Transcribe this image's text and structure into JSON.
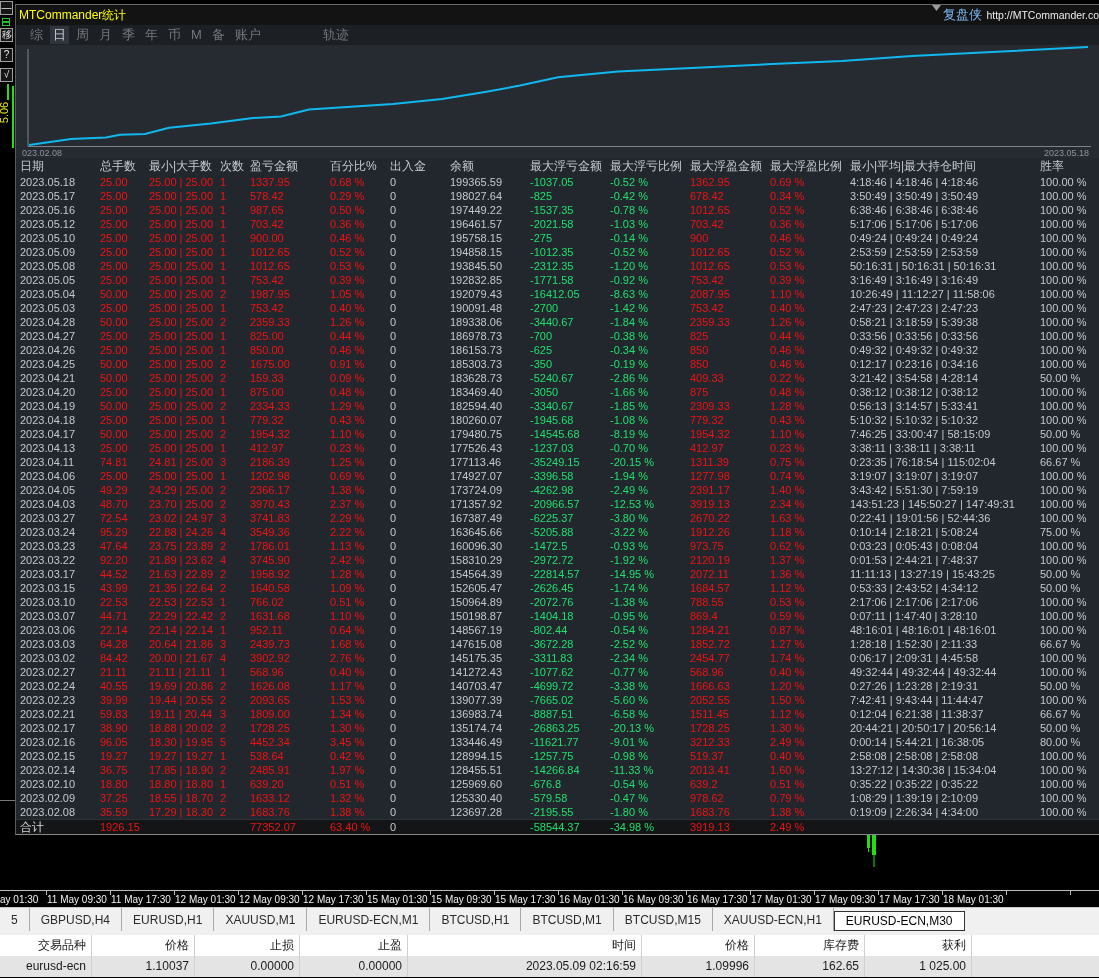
{
  "left_toolbar": {
    "buttons": [
      "—",
      "移",
      "?",
      "√"
    ],
    "price_label": "5.06"
  },
  "panel": {
    "title": "MTCommander统计",
    "brand": "复盘侠",
    "url": "http://MTCommander.co"
  },
  "tabs": [
    {
      "label": "综",
      "selected": false
    },
    {
      "label": "日",
      "selected": true
    },
    {
      "label": "周",
      "selected": false
    },
    {
      "label": "月",
      "selected": false
    },
    {
      "label": "季",
      "selected": false
    },
    {
      "label": "年",
      "selected": false
    },
    {
      "label": "币",
      "selected": false
    },
    {
      "label": "M",
      "selected": false
    },
    {
      "label": "备",
      "selected": false
    },
    {
      "label": "账户",
      "selected": false
    }
  ],
  "track_tab": {
    "label": "轨迹",
    "selected": false
  },
  "equity_chart": {
    "start_label": "023.02.08",
    "end_label": "2023.05.18"
  },
  "stats_table": {
    "columns": [
      "日期",
      "总手数",
      "最小|大手数",
      "次数",
      "盈亏金额",
      "百分比%",
      "出入金",
      "余额",
      "最大浮亏金额",
      "最大浮亏比例",
      "最大浮盈金额",
      "最大浮盈比例",
      "最小|平均|最大持仓时间",
      "胜率"
    ],
    "rows": [
      [
        "2023.05.18",
        "25.00",
        "25.00 | 25.00",
        "1",
        "1337.95",
        "0.68 %",
        "0",
        "199365.59",
        "-1037.05",
        "-0.52 %",
        "1362.95",
        "0.69 %",
        "4:18:46 | 4:18:46 | 4:18:46",
        "100.00 %"
      ],
      [
        "2023.05.17",
        "25.00",
        "25.00 | 25.00",
        "1",
        "578.42",
        "0.29 %",
        "0",
        "198027.64",
        "-825",
        "-0.42 %",
        "678.42",
        "0.34 %",
        "3:50:49 | 3:50:49 | 3:50:49",
        "100.00 %"
      ],
      [
        "2023.05.16",
        "25.00",
        "25.00 | 25.00",
        "1",
        "987.65",
        "0.50 %",
        "0",
        "197449.22",
        "-1537.35",
        "-0.78 %",
        "1012.65",
        "0.52 %",
        "6:38:46 | 6:38:46 | 6:38:46",
        "100.00 %"
      ],
      [
        "2023.05.12",
        "25.00",
        "25.00 | 25.00",
        "1",
        "703.42",
        "0.36 %",
        "0",
        "196461.57",
        "-2021.58",
        "-1.03 %",
        "703.42",
        "0.36 %",
        "5:17:06 | 5:17:06 | 5:17:06",
        "100.00 %"
      ],
      [
        "2023.05.10",
        "25.00",
        "25.00 | 25.00",
        "1",
        "900.00",
        "0.46 %",
        "0",
        "195758.15",
        "-275",
        "-0.14 %",
        "900",
        "0.46 %",
        "0:49:24 | 0:49:24 | 0:49:24",
        "100.00 %"
      ],
      [
        "2023.05.09",
        "25.00",
        "25.00 | 25.00",
        "1",
        "1012.65",
        "0.52 %",
        "0",
        "194858.15",
        "-1012.35",
        "-0.52 %",
        "1012.65",
        "0.52 %",
        "2:53:59 | 2:53:59 | 2:53:59",
        "100.00 %"
      ],
      [
        "2023.05.08",
        "25.00",
        "25.00 | 25.00",
        "1",
        "1012.65",
        "0.53 %",
        "0",
        "193845.50",
        "-2312.35",
        "-1.20 %",
        "1012.65",
        "0.53 %",
        "50:16:31 | 50:16:31 | 50:16:31",
        "100.00 %"
      ],
      [
        "2023.05.05",
        "25.00",
        "25.00 | 25.00",
        "1",
        "753.42",
        "0.39 %",
        "0",
        "192832.85",
        "-1771.58",
        "-0.92 %",
        "753.42",
        "0.39 %",
        "3:16:49 | 3:16:49 | 3:16:49",
        "100.00 %"
      ],
      [
        "2023.05.04",
        "50.00",
        "25.00 | 25.00",
        "2",
        "1987.95",
        "1.05 %",
        "0",
        "192079.43",
        "-16412.05",
        "-8.63 %",
        "2087.95",
        "1.10 %",
        "10:26:49 | 11:12:27 | 11:58:06",
        "100.00 %"
      ],
      [
        "2023.05.03",
        "25.00",
        "25.00 | 25.00",
        "1",
        "753.42",
        "0.40 %",
        "0",
        "190091.48",
        "-2700",
        "-1.42 %",
        "753.42",
        "0.40 %",
        "2:47:23 | 2:47:23 | 2:47:23",
        "100.00 %"
      ],
      [
        "2023.04.28",
        "50.00",
        "25.00 | 25.00",
        "2",
        "2359.33",
        "1.26 %",
        "0",
        "189338.06",
        "-3440.67",
        "-1.84 %",
        "2359.33",
        "1.26 %",
        "0:58:21 | 3:18:59 | 5:39:38",
        "100.00 %"
      ],
      [
        "2023.04.27",
        "25.00",
        "25.00 | 25.00",
        "1",
        "825.00",
        "0.44 %",
        "0",
        "186978.73",
        "-700",
        "-0.38 %",
        "825",
        "0.44 %",
        "0:33:56 | 0:33:56 | 0:33:56",
        "100.00 %"
      ],
      [
        "2023.04.26",
        "25.00",
        "25.00 | 25.00",
        "1",
        "850.00",
        "0.46 %",
        "0",
        "186153.73",
        "-625",
        "-0.34 %",
        "850",
        "0.46 %",
        "0:49:32 | 0:49:32 | 0:49:32",
        "100.00 %"
      ],
      [
        "2023.04.25",
        "50.00",
        "25.00 | 25.00",
        "2",
        "1675.00",
        "0.91 %",
        "0",
        "185303.73",
        "-350",
        "-0.19 %",
        "850",
        "0.46 %",
        "0:12:17 | 0:23:16 | 0:34:16",
        "100.00 %"
      ],
      [
        "2023.04.21",
        "50.00",
        "25.00 | 25.00",
        "2",
        "159.33",
        "0.09 %",
        "0",
        "183628.73",
        "-5240.67",
        "-2.86 %",
        "409.33",
        "0.22 %",
        "3:21:42 | 3:54:58 | 4:28:14",
        "50.00 %"
      ],
      [
        "2023.04.20",
        "25.00",
        "25.00 | 25.00",
        "1",
        "875.00",
        "0.48 %",
        "0",
        "183469.40",
        "-3050",
        "-1.66 %",
        "875",
        "0.48 %",
        "0:38:12 | 0:38:12 | 0:38:12",
        "100.00 %"
      ],
      [
        "2023.04.19",
        "50.00",
        "25.00 | 25.00",
        "2",
        "2334.33",
        "1.29 %",
        "0",
        "182594.40",
        "-3340.67",
        "-1.85 %",
        "2309.33",
        "1.28 %",
        "0:56:13 | 3:14:57 | 5:33:41",
        "100.00 %"
      ],
      [
        "2023.04.18",
        "25.00",
        "25.00 | 25.00",
        "1",
        "779.32",
        "0.43 %",
        "0",
        "180260.07",
        "-1945.68",
        "-1.08 %",
        "779.32",
        "0.43 %",
        "5:10:32 | 5:10:32 | 5:10:32",
        "100.00 %"
      ],
      [
        "2023.04.17",
        "50.00",
        "25.00 | 25.00",
        "2",
        "1954.32",
        "1.10 %",
        "0",
        "179480.75",
        "-14545.68",
        "-8.19 %",
        "1954.32",
        "1.10 %",
        "7:46:25 | 33:00:47 | 58:15:09",
        "50.00 %"
      ],
      [
        "2023.04.13",
        "25.00",
        "25.00 | 25.00",
        "1",
        "412.97",
        "0.23 %",
        "0",
        "177526.43",
        "-1237.03",
        "-0.70 %",
        "412.97",
        "0.23 %",
        "3:38:11 | 3:38:11 | 3:38:11",
        "100.00 %"
      ],
      [
        "2023.04.11",
        "74.81",
        "24.81 | 25.00",
        "3",
        "2186.39",
        "1.25 %",
        "0",
        "177113.46",
        "-35249.15",
        "-20.15 %",
        "1311.39",
        "0.75 %",
        "0:23:35 | 76:18:54 | 115:02:04",
        "66.67 %"
      ],
      [
        "2023.04.06",
        "25.00",
        "25.00 | 25.00",
        "1",
        "1202.98",
        "0.69 %",
        "0",
        "174927.07",
        "-3396.58",
        "-1.94 %",
        "1277.98",
        "0.74 %",
        "3:19:07 | 3:19:07 | 3:19:07",
        "100.00 %"
      ],
      [
        "2023.04.05",
        "49.29",
        "24.29 | 25.00",
        "2",
        "2366.17",
        "1.38 %",
        "0",
        "173724.09",
        "-4262.98",
        "-2.49 %",
        "2391.17",
        "1.40 %",
        "3:43:42 | 5:51:30 | 7:59:19",
        "100.00 %"
      ],
      [
        "2023.04.03",
        "48.70",
        "23.70 | 25.00",
        "2",
        "3970.43",
        "2.37 %",
        "0",
        "171357.92",
        "-20966.57",
        "-12.53 %",
        "3919.13",
        "2.34 %",
        "143:51:23 | 145:50:27 | 147:49:31",
        "100.00 %"
      ],
      [
        "2023.03.27",
        "72.54",
        "23.02 | 24.97",
        "3",
        "3741.83",
        "2.29 %",
        "0",
        "167387.49",
        "-6225.37",
        "-3.80 %",
        "2670.22",
        "1.63 %",
        "0:22:41 | 19:01:56 | 52:44:36",
        "100.00 %"
      ],
      [
        "2023.03.24",
        "95.29",
        "22.88 | 24.26",
        "4",
        "3549.36",
        "2.22 %",
        "0",
        "163645.66",
        "-5205.88",
        "-3.22 %",
        "1912.26",
        "1.18 %",
        "0:10:14 | 2:18:21 | 5:08:24",
        "75.00 %"
      ],
      [
        "2023.03.23",
        "47.64",
        "23.75 | 23.89",
        "2",
        "1786.01",
        "1.13 %",
        "0",
        "160096.30",
        "-1472.5",
        "-0.93 %",
        "973.75",
        "0.62 %",
        "0:03:23 | 0:05:43 | 0:08:04",
        "100.00 %"
      ],
      [
        "2023.03.22",
        "92.20",
        "21.89 | 23.62",
        "4",
        "3745.90",
        "2.42 %",
        "0",
        "158310.29",
        "-2972.72",
        "-1.92 %",
        "2120.19",
        "1.37 %",
        "0:01:53 | 2:44:21 | 7:48:37",
        "100.00 %"
      ],
      [
        "2023.03.17",
        "44.52",
        "21.63 | 22.89",
        "2",
        "1958.92",
        "1.28 %",
        "0",
        "154564.39",
        "-22814.57",
        "-14.95 %",
        "2072.11",
        "1.36 %",
        "11:11:13 | 13:27:19 | 15:43:25",
        "50.00 %"
      ],
      [
        "2023.03.15",
        "43.99",
        "21.35 | 22.64",
        "2",
        "1640.58",
        "1.09 %",
        "0",
        "152605.47",
        "-2626.45",
        "-1.74 %",
        "1684.57",
        "1.12 %",
        "0:53:33 | 2:43:52 | 4:34:12",
        "50.00 %"
      ],
      [
        "2023.03.10",
        "22.53",
        "22.53 | 22.53",
        "1",
        "766.02",
        "0.51 %",
        "0",
        "150964.89",
        "-2072.76",
        "-1.38 %",
        "788.55",
        "0.53 %",
        "2:17:06 | 2:17:06 | 2:17:06",
        "100.00 %"
      ],
      [
        "2023.03.07",
        "44.71",
        "22.29 | 22.42",
        "2",
        "1631.68",
        "1.10 %",
        "0",
        "150198.87",
        "-1404.18",
        "-0.95 %",
        "869.4",
        "0.59 %",
        "0:07:11 | 1:47:40 | 3:28:10",
        "100.00 %"
      ],
      [
        "2023.03.06",
        "22.14",
        "22.14 | 22.14",
        "1",
        "952.11",
        "0.64 %",
        "0",
        "148567.19",
        "-802.44",
        "-0.54 %",
        "1284.21",
        "0.87 %",
        "48:16:01 | 48:16:01 | 48:16:01",
        "100.00 %"
      ],
      [
        "2023.03.03",
        "64.28",
        "20.64 | 21.86",
        "3",
        "2439.73",
        "1.68 %",
        "0",
        "147615.08",
        "-3672.28",
        "-2.52 %",
        "1852.72",
        "1.27 %",
        "1:28:18 | 1:52:30 | 2:11:33",
        "66.67 %"
      ],
      [
        "2023.03.02",
        "84.42",
        "20.00 | 21.67",
        "4",
        "3902.92",
        "2.76 %",
        "0",
        "145175.35",
        "-3311.83",
        "-2.34 %",
        "2454.77",
        "1.74 %",
        "0:06:17 | 2:09:31 | 4:45:58",
        "100.00 %"
      ],
      [
        "2023.02.27",
        "21.11",
        "21.11 | 21.11",
        "1",
        "568.96",
        "0.40 %",
        "0",
        "141272.43",
        "-1077.62",
        "-0.77 %",
        "568.96",
        "0.40 %",
        "49:32:44 | 49:32:44 | 49:32:44",
        "100.00 %"
      ],
      [
        "2023.02.24",
        "40.55",
        "19.69 | 20.86",
        "2",
        "1626.08",
        "1.17 %",
        "0",
        "140703.47",
        "-4699.72",
        "-3.38 %",
        "1666.63",
        "1.20 %",
        "0:27:26 | 1:23:28 | 2:19:31",
        "50.00 %"
      ],
      [
        "2023.02.23",
        "39.99",
        "19.44 | 20.55",
        "2",
        "2093.65",
        "1.53 %",
        "0",
        "139077.39",
        "-7665.02",
        "-5.60 %",
        "2052.55",
        "1.50 %",
        "7:42:41 | 9:43:44 | 11:44:47",
        "100.00 %"
      ],
      [
        "2023.02.21",
        "59.83",
        "19.11 | 20.44",
        "3",
        "1809.00",
        "1.34 %",
        "0",
        "136983.74",
        "-8887.51",
        "-6.58 %",
        "1511.45",
        "1.12 %",
        "0:12:04 | 6:21:38 | 11:38:37",
        "66.67 %"
      ],
      [
        "2023.02.17",
        "38.90",
        "18.88 | 20.02",
        "2",
        "1728.25",
        "1.30 %",
        "0",
        "135174.74",
        "-26863.25",
        "-20.13 %",
        "1728.25",
        "1.30 %",
        "20:44:21 | 20:50:17 | 20:56:14",
        "50.00 %"
      ],
      [
        "2023.02.16",
        "96.05",
        "18.30 | 19.95",
        "5",
        "4452.34",
        "3.45 %",
        "0",
        "133446.49",
        "-11621.77",
        "-9.01 %",
        "3212.33",
        "2.49 %",
        "0:00:14 | 5:44:21 | 16:38:05",
        "80.00 %"
      ],
      [
        "2023.02.15",
        "19.27",
        "19.27 | 19.27",
        "1",
        "538.64",
        "0.42 %",
        "0",
        "128994.15",
        "-1257.75",
        "-0.98 %",
        "519.37",
        "0.40 %",
        "2:58:08 | 2:58:08 | 2:58:08",
        "100.00 %"
      ],
      [
        "2023.02.14",
        "36.75",
        "17.85 | 18.90",
        "2",
        "2485.91",
        "1.97 %",
        "0",
        "128455.51",
        "-14266.84",
        "-11.33 %",
        "2013.41",
        "1.60 %",
        "13:27:12 | 14:30:38 | 15:34:04",
        "100.00 %"
      ],
      [
        "2023.02.10",
        "18.80",
        "18.80 | 18.80",
        "1",
        "639.20",
        "0.51 %",
        "0",
        "125969.60",
        "-676.8",
        "-0.54 %",
        "639.2",
        "0.51 %",
        "0:35:22 | 0:35:22 | 0:35:22",
        "100.00 %"
      ],
      [
        "2023.02.09",
        "37.25",
        "18.55 | 18.70",
        "2",
        "1633.12",
        "1.32 %",
        "0",
        "125330.40",
        "-579.58",
        "-0.47 %",
        "978.62",
        "0.79 %",
        "1:08:29 | 1:39:19 | 2:10:09",
        "100.00 %"
      ],
      [
        "2023.02.08",
        "35.59",
        "17.29 | 18.30",
        "2",
        "1683.76",
        "1.38 %",
        "0",
        "123697.28",
        "-2195.55",
        "-1.80 %",
        "1683.76",
        "1.38 %",
        "0:19:09 | 2:26:34 | 4:34:00",
        "100.00 %"
      ]
    ],
    "total": {
      "label": "合计",
      "total_lots": "1926.15",
      "profit": "77352.07",
      "percent": "63.40 %",
      "deposit": "0",
      "max_float_loss": "-58544.37",
      "max_float_loss_pct": "-34.98 %",
      "max_float_profit": "3919.13",
      "max_float_profit_pct": "2.49 %"
    }
  },
  "time_axis": {
    "labels": [
      "ay 01:30",
      "11 May 09:30",
      "11 May 17:30",
      "12 May 01:30",
      "12 May 09:30",
      "12 May 17:30",
      "15 May 01:30",
      "15 May 09:30",
      "15 May 17:30",
      "16 May 01:30",
      "16 May 09:30",
      "16 May 17:30",
      "17 May 01:30",
      "17 May 09:30",
      "17 May 17:30",
      "18 May 01:30"
    ]
  },
  "chart_tabs": [
    {
      "label": "5",
      "selected": false
    },
    {
      "label": "GBPUSD,H4",
      "selected": false
    },
    {
      "label": "EURUSD,H1",
      "selected": false
    },
    {
      "label": "XAUUSD,M1",
      "selected": false
    },
    {
      "label": "EURUSD-ECN,M1",
      "selected": false
    },
    {
      "label": "BTCUSD,H1",
      "selected": false
    },
    {
      "label": "BTCUSD,M1",
      "selected": false
    },
    {
      "label": "BTCUSD,M15",
      "selected": false
    },
    {
      "label": "XAUUSD-ECN,H1",
      "selected": false
    },
    {
      "label": "EURUSD-ECN,M30",
      "selected": true
    }
  ],
  "trade_table": {
    "columns": [
      "交易品种",
      "价格",
      "止损",
      "止盈",
      "时间",
      "价格",
      "库存费",
      "获利"
    ],
    "rows": [
      [
        "eurusd-ecn",
        "1.10037",
        "0.00000",
        "0.00000",
        "2023.05.09 02:16:59",
        "1.09996",
        "162.65",
        "1 025.00"
      ]
    ]
  }
}
